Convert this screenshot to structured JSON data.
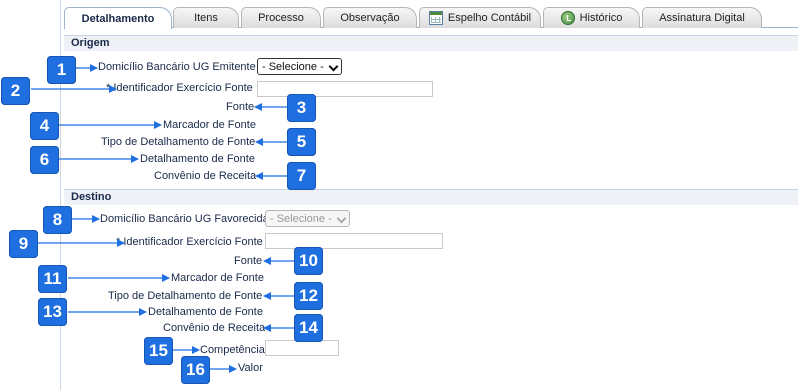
{
  "tabs": [
    {
      "label": "Detalhamento"
    },
    {
      "label": "Itens"
    },
    {
      "label": "Processo"
    },
    {
      "label": "Observação"
    },
    {
      "label": "Espelho Contábil"
    },
    {
      "label": "Histórico"
    },
    {
      "label": "Assinatura Digital"
    }
  ],
  "origem": {
    "title": "Origem",
    "domicilio_label": "Domicílio Bancário UG Emitente",
    "domicilio_value": "- Selecione -",
    "identificador_label": "Identificador Exercício Fonte",
    "fonte_label": "Fonte",
    "marcador_label": "Marcador de Fonte",
    "tipo_detalhamento_label": "Tipo de Detalhamento de Fonte",
    "detalhamento_label": "Detalhamento de Fonte",
    "convenio_label": "Convênio de Receita"
  },
  "destino": {
    "title": "Destino",
    "domicilio_label": "Domicílio Bancário UG Favorecida",
    "domicilio_value": "- Selecione -",
    "identificador_label": "Identificador Exercício Fonte",
    "fonte_label": "Fonte",
    "marcador_label": "Marcador de Fonte",
    "tipo_detalhamento_label": "Tipo de Detalhamento de Fonte",
    "detalhamento_label": "Detalhamento de Fonte",
    "convenio_label": "Convênio de Receita",
    "competencia_label": "Competência",
    "valor_label": "Valor"
  },
  "required_marker": "*",
  "callouts": [
    "1",
    "2",
    "3",
    "4",
    "5",
    "6",
    "7",
    "8",
    "9",
    "10",
    "11",
    "12",
    "13",
    "14",
    "15",
    "16"
  ],
  "colors": {
    "callout": "#1f6fe0",
    "section_header_bg": "#eef2f7",
    "label_text": "#1a2a4a"
  }
}
